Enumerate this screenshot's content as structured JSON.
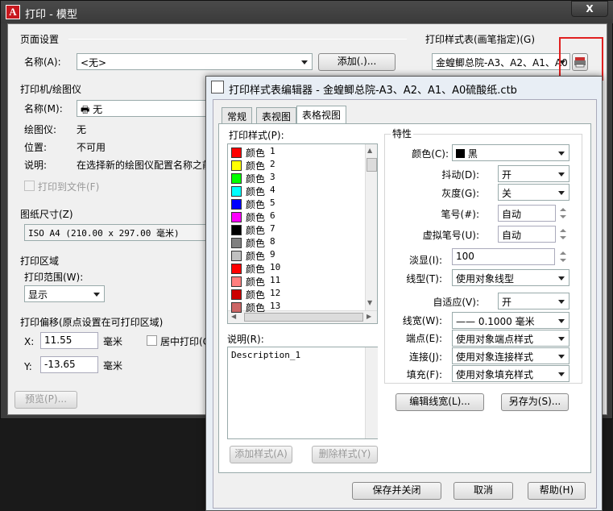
{
  "print_dialog": {
    "title": "打印 - 模型",
    "close_label": "X",
    "page_setup": {
      "label": "页面设置",
      "name_label": "名称(A):",
      "name_value": "<无>",
      "add_button": "添加(.)..."
    },
    "plotter": {
      "label": "打印机/绘图仪",
      "name_label": "名称(M):",
      "name_value": "无",
      "plotter_label": "绘图仪:",
      "plotter_value": "无",
      "location_label": "位置:",
      "location_value": "不可用",
      "description_label": "说明:",
      "description_value": "在选择新的绘图仪配置名称之前",
      "print_to_file": "打印到文件(F)"
    },
    "paper_size": {
      "label": "图纸尺寸(Z)",
      "value": "ISO A4 (210.00 x 297.00 毫米)"
    },
    "plot_area": {
      "label": "打印区域",
      "range_label": "打印范围(W):",
      "range_value": "显示"
    },
    "plot_offset": {
      "label": "打印偏移(原点设置在可打印区域)",
      "x_label": "X:",
      "x_value": "11.55",
      "x_unit": "毫米",
      "y_label": "Y:",
      "y_value": "-13.65",
      "y_unit": "毫米",
      "center_label": "居中打印(C"
    },
    "preview_button": "预览(P)...",
    "plot_style_table": {
      "label": "打印样式表(画笔指定)(G)",
      "value": "金蝗鲫总院-A3、A2、A1、A0"
    }
  },
  "editor": {
    "title": "打印样式表编辑器 - 金蝗鲫总院-A3、A2、A1、A0硫酸纸.ctb",
    "tabs": [
      "常规",
      "表视图",
      "表格视图"
    ],
    "active_tab": 2,
    "styles_label": "打印样式(P):",
    "styles": [
      {
        "name": "颜色",
        "num": "1",
        "color": "#ff0000"
      },
      {
        "name": "颜色",
        "num": "2",
        "color": "#ffff00"
      },
      {
        "name": "颜色",
        "num": "3",
        "color": "#00ff00"
      },
      {
        "name": "颜色",
        "num": "4",
        "color": "#00ffff"
      },
      {
        "name": "颜色",
        "num": "5",
        "color": "#0000ff"
      },
      {
        "name": "颜色",
        "num": "6",
        "color": "#ff00ff"
      },
      {
        "name": "颜色",
        "num": "7",
        "color": "#000000"
      },
      {
        "name": "颜色",
        "num": "8",
        "color": "#808080"
      },
      {
        "name": "颜色",
        "num": "9",
        "color": "#c0c0c0"
      },
      {
        "name": "颜色",
        "num": "10",
        "color": "#ff0000"
      },
      {
        "name": "颜色",
        "num": "11",
        "color": "#ff7f7f"
      },
      {
        "name": "颜色",
        "num": "12",
        "color": "#cc0000"
      },
      {
        "name": "颜色",
        "num": "13",
        "color": "#cc6666"
      }
    ],
    "description_label": "说明(R):",
    "description_value": "Description_1",
    "add_style_button": "添加样式(A)",
    "delete_style_button": "删除样式(Y)",
    "properties": {
      "label": "特性",
      "color_label": "颜色(C):",
      "color_value": "黑",
      "dither_label": "抖动(D):",
      "dither_value": "开",
      "grayscale_label": "灰度(G):",
      "grayscale_value": "关",
      "pen_label": "笔号(#):",
      "pen_value": "自动",
      "virtual_pen_label": "虚拟笔号(U):",
      "virtual_pen_value": "自动",
      "screening_label": "淡显(I):",
      "screening_value": "100",
      "linetype_label": "线型(T):",
      "linetype_value": "使用对象线型",
      "adaptive_label": "自适应(V):",
      "adaptive_value": "开",
      "lineweight_label": "线宽(W):",
      "lineweight_value": "—— 0.1000 毫米",
      "endstyle_label": "端点(E):",
      "endstyle_value": "使用对象端点样式",
      "joinstyle_label": "连接(J):",
      "joinstyle_value": "使用对象连接样式",
      "fillstyle_label": "填充(F):",
      "fillstyle_value": "使用对象填充样式",
      "edit_lineweights_button": "编辑线宽(L)...",
      "save_as_button": "另存为(S)..."
    },
    "save_close_button": "保存并关闭",
    "cancel_button": "取消",
    "help_button": "帮助(H)"
  }
}
